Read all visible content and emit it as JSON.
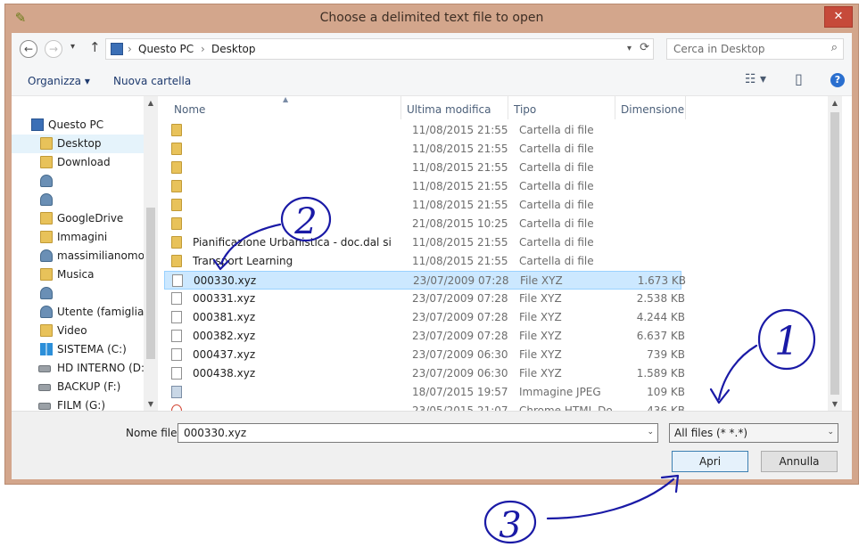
{
  "window": {
    "title": "Choose a delimited text file to open",
    "close_glyph": "✕",
    "accent_color": "#d3a68c"
  },
  "nav": {
    "back_glyph": "←",
    "forward_glyph": "→",
    "recent_glyph": "▾",
    "up_glyph": "↑"
  },
  "address": {
    "crumbs": [
      "Questo PC",
      "Desktop"
    ],
    "sep": "›",
    "refresh_glyph": "⟳"
  },
  "search": {
    "placeholder": "Cerca in Desktop",
    "icon_glyph": "⌕"
  },
  "toolbar": {
    "organize_label": "Organizza ▾",
    "new_folder_label": "Nuova cartella",
    "view_glyph": "☷ ▾",
    "preview_glyph": "▯",
    "help_glyph": "?"
  },
  "sidebar": {
    "items": [
      {
        "label": "Questo PC",
        "icon": "computer-icon"
      },
      {
        "label": "Desktop",
        "icon": "folder-icon"
      },
      {
        "label": "Download",
        "icon": "folder-icon"
      },
      {
        "label": "",
        "icon": "network-user-icon"
      },
      {
        "label": "",
        "icon": "network-user-icon"
      },
      {
        "label": "GoogleDrive",
        "icon": "folder-icon"
      },
      {
        "label": "Immagini",
        "icon": "folder-icon"
      },
      {
        "label": "massimilianomo",
        "icon": "network-user-icon"
      },
      {
        "label": "Musica",
        "icon": "folder-icon"
      },
      {
        "label": "",
        "icon": "network-user-icon"
      },
      {
        "label": "Utente (famiglia)",
        "icon": "network-user-icon"
      },
      {
        "label": "Video",
        "icon": "folder-icon"
      },
      {
        "label": "SISTEMA (C:)",
        "icon": "windows-drive-icon"
      },
      {
        "label": "HD INTERNO (D:",
        "icon": "drive-icon"
      },
      {
        "label": "BACKUP (F:)",
        "icon": "drive-icon"
      },
      {
        "label": "FILM (G:)",
        "icon": "drive-icon"
      }
    ]
  },
  "columns": {
    "name": "Nome",
    "modified": "Ultima modifica",
    "type": "Tipo",
    "size": "Dimensione"
  },
  "files": [
    {
      "name": "",
      "modified": "11/08/2015 21:55",
      "type": "Cartella di file",
      "size": "",
      "icon": "folder-icon"
    },
    {
      "name": "",
      "modified": "11/08/2015 21:55",
      "type": "Cartella di file",
      "size": "",
      "icon": "folder-icon"
    },
    {
      "name": "",
      "modified": "11/08/2015 21:55",
      "type": "Cartella di file",
      "size": "",
      "icon": "folder-icon"
    },
    {
      "name": "",
      "modified": "11/08/2015 21:55",
      "type": "Cartella di file",
      "size": "",
      "icon": "folder-icon"
    },
    {
      "name": "",
      "modified": "11/08/2015 21:55",
      "type": "Cartella di file",
      "size": "",
      "icon": "folder-icon"
    },
    {
      "name": "",
      "modified": "21/08/2015 10:25",
      "type": "Cartella di file",
      "size": "",
      "icon": "folder-icon"
    },
    {
      "name": "Pianificazione Urbanistica - doc.dal sito d...",
      "modified": "11/08/2015 21:55",
      "type": "Cartella di file",
      "size": "",
      "icon": "folder-icon"
    },
    {
      "name": "Transport Learning",
      "modified": "11/08/2015 21:55",
      "type": "Cartella di file",
      "size": "",
      "icon": "folder-icon"
    },
    {
      "name": "000330.xyz",
      "modified": "23/07/2009 07:28",
      "type": "File XYZ",
      "size": "1.673 KB",
      "icon": "file-icon",
      "selected": true
    },
    {
      "name": "000331.xyz",
      "modified": "23/07/2009 07:28",
      "type": "File XYZ",
      "size": "2.538 KB",
      "icon": "file-icon"
    },
    {
      "name": "000381.xyz",
      "modified": "23/07/2009 07:28",
      "type": "File XYZ",
      "size": "4.244 KB",
      "icon": "file-icon"
    },
    {
      "name": "000382.xyz",
      "modified": "23/07/2009 07:28",
      "type": "File XYZ",
      "size": "6.637 KB",
      "icon": "file-icon"
    },
    {
      "name": "000437.xyz",
      "modified": "23/07/2009 06:30",
      "type": "File XYZ",
      "size": "739 KB",
      "icon": "file-icon"
    },
    {
      "name": "000438.xyz",
      "modified": "23/07/2009 06:30",
      "type": "File XYZ",
      "size": "1.589 KB",
      "icon": "file-icon"
    },
    {
      "name": "",
      "modified": "18/07/2015 19:57",
      "type": "Immagine JPEG",
      "size": "109 KB",
      "icon": "image-icon"
    },
    {
      "name": "",
      "modified": "23/05/2015 21:07",
      "type": "Chrome HTML Do...",
      "size": "436 KB",
      "icon": "html-icon"
    }
  ],
  "footer": {
    "filename_label": "Nome file:",
    "filename_value": "000330.xyz",
    "filter_value": "All files (* *.*)",
    "open_label": "Apri",
    "cancel_label": "Annulla",
    "dropdown_glyph": "⌄"
  },
  "annotations": {
    "labels": [
      "1",
      "2",
      "3"
    ],
    "ink_color": "#1a1aa6"
  }
}
